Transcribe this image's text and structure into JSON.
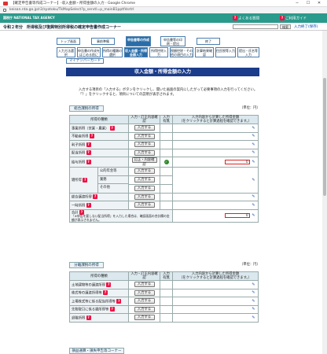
{
  "browser": {
    "title": "【確定申告書等作成コーナー】-収入金額・所得金額の入力 - Google Chrome",
    "url": "keisan.nta.go.jp/r2/syotoku/TkMapSelect?p_servtl=p_mainB1pptfdsrtrl"
  },
  "header": {
    "agency": "国税庁 NATIONAL TAX AGENCY",
    "help_link": "よくある質問",
    "usage_link": "ご利用ガイド"
  },
  "subheader": {
    "app_title": "令和２年分　所得税及び復興特別所得税の確定申告書作成コーナー",
    "search_button": "検索",
    "help_link": "入力終了(保存)"
  },
  "steps": {
    "top": [
      {
        "label": "トップ画面"
      },
      {
        "label": "事前準備"
      },
      {
        "label": "申告書等の作成"
      },
      {
        "label": "申告書等の印刷・提出"
      },
      {
        "label": "終了"
      }
    ],
    "sub": [
      {
        "label": "入力方法選択"
      },
      {
        "label": "申告書の作成をはじめる前に"
      },
      {
        "label": "所得の種類の選択"
      },
      {
        "label": "収入金額・所得金額入力"
      },
      {
        "label": "所得控除入力"
      },
      {
        "label": "税額控除・その他の項目の入力"
      },
      {
        "label": "計算結果確認"
      },
      {
        "label": "住民税等入力"
      },
      {
        "label": "提出・氏名等入力"
      }
    ]
  },
  "mynumber": "マイナンバーカード",
  "main_title": "収入金額・所得金額の入力",
  "intro_line1": "入力する項目の「入力する」ボタンをクリックし、開いた画面の案内にしたがって必要事項の入力を行ってください。",
  "intro_line2": "「？」をクリックすると、項目についての説明が表示されます。",
  "sogo": {
    "section_label": "総合課税の所得",
    "unit": "（単位：円）",
    "headers": {
      "type": "所得の種類",
      "action": "入力・訂正内容確認",
      "status": "入力有無",
      "amount": "入力内容から計算した所得金額",
      "amount_sub": "（をクリックすると計算過程を確認できます。）"
    },
    "rows": [
      {
        "name": "事業所得（営業・農業）",
        "button": "入力する",
        "amount": ""
      },
      {
        "name": "不動産所得",
        "button": "入力する",
        "amount": ""
      },
      {
        "name": "利子所得",
        "button": "入力する",
        "amount": ""
      },
      {
        "name": "配当所得",
        "button": "入力する",
        "amount": ""
      },
      {
        "name": "給与所得",
        "button": "訂正・内容確認",
        "amount": "0"
      }
    ],
    "zatsu": {
      "name": "雑所得",
      "subs": [
        {
          "name": "公的年金等",
          "button": "入力する"
        },
        {
          "name": "業務",
          "button": "入力する"
        },
        {
          "name": "その他",
          "button": "入力する"
        }
      ]
    },
    "sogojoto": {
      "name": "総合譲渡所得",
      "button": "入力する"
    },
    "ichiji": {
      "name": "一時所得",
      "button": "入力する"
    },
    "total_label": "合計",
    "total_amount": "0",
    "total_note": "「※申告を要しない配当所得」を入力した場合は、確認画面の合計欄の金額が表示されません。"
  },
  "bunri": {
    "section_label": "分離課税の所得",
    "unit": "（単位：円）",
    "headers": {
      "type": "所得の種類",
      "action": "入力・訂正内容確認",
      "status": "入力有無",
      "amount": "入力内容から計算した所得金額",
      "amount_sub": "（をクリックすると計算過程を確認できます。）"
    },
    "rows": [
      {
        "name": "土地建物等の譲渡所得",
        "button": "入力する"
      },
      {
        "name": "株式等の譲渡所得等",
        "button": "入力する"
      },
      {
        "name": "上場株式等に係る配当所得等",
        "button": "入力する"
      },
      {
        "name": "先物取引に係る雑所得等",
        "button": "入力する"
      },
      {
        "name": "退職所得",
        "button": "入力する"
      }
    ]
  },
  "bottom_section": "損益通算・損失申告等コーナー"
}
